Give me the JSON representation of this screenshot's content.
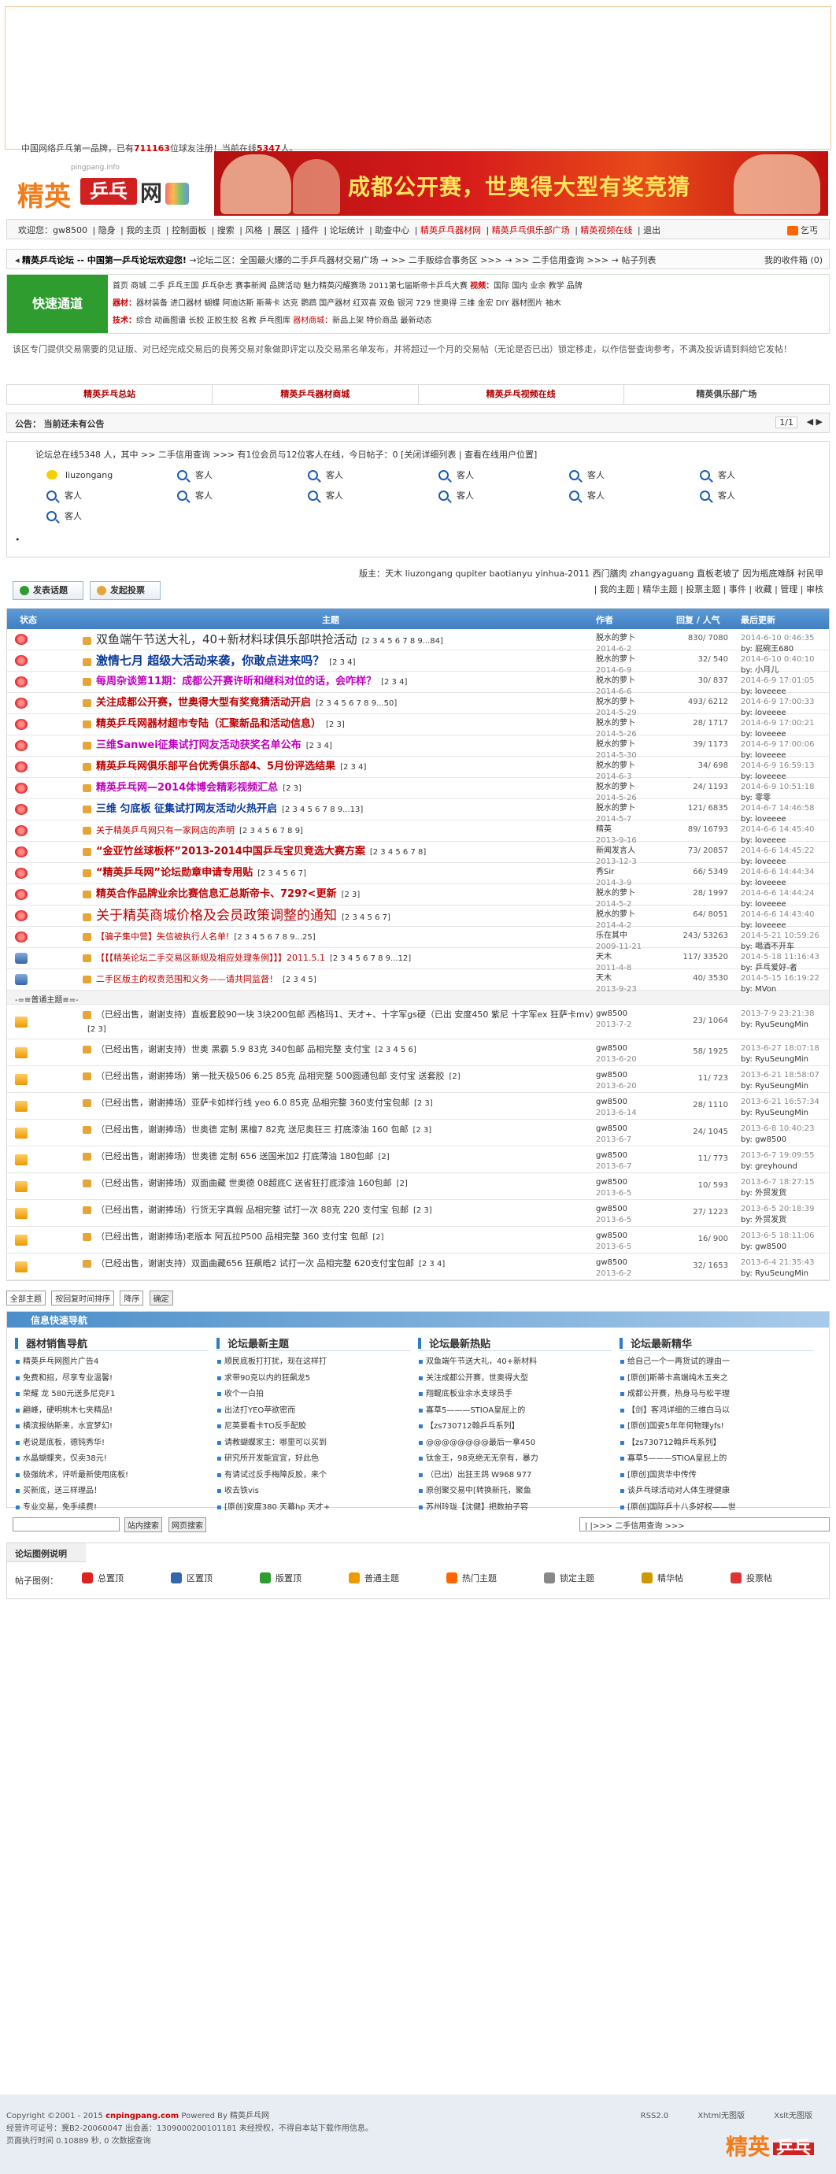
{
  "header": {
    "tagline_pre": "中国网络乒乓第一品牌，已有",
    "registered": "711163",
    "tagline_mid": "位球友注册！当前在线",
    "online_count": "5347",
    "tagline_post": "人。",
    "logo": {
      "sub": "pingpang.info",
      "t1": "精英",
      "t2": "乒乓",
      "t3": "网"
    },
    "banner_text": "成都公开赛，世奥得大型有奖竞猜"
  },
  "usernav": {
    "items": [
      "欢迎您：gw8500",
      "隐身",
      "我的主页",
      "控制面板",
      "搜索",
      "风格",
      "展区",
      "插件",
      "论坛统计",
      "助查中心"
    ],
    "hot_items": [
      "精英乒乓器材网",
      "精英乒乓俱乐部广场",
      "精英视频在线"
    ],
    "exit": "退出",
    "rss": "订阅",
    "right": "乞丐"
  },
  "crumb": {
    "prefix": "精英乒乓论坛 -- 中国第一乒乓论坛欢迎您!",
    "path": "→论坛二区：全国最火爆的二手乒乓器材交易广场 → >> 二手贩综合事务区 >>> → >> 二手信用查询 >>> → 帖子列表",
    "right": "我的收件箱 (0)"
  },
  "quick": {
    "title": "快速通道",
    "row1": "首页 商城 二手 乒乓王国 乒乓杂志 赛事新闻 品牌活动 魅力精英闪耀赛场 2011第七届斯帝卡乒乓大赛",
    "row1_lbl": "视频：",
    "row1_tail": "国际 国内 业余 教学 品牌",
    "row2_lbl": "器材：",
    "row2": "器材装备 进口器材 蝴蝶 阿迪达斯 斯蒂卡 达克 鹦鹉 国产器材 红双喜 双鱼 银河 729 世奥得 三维 金宏 DIY 器材图片 袖木",
    "row3_lbl": "技术：",
    "row3": "综合 动画图谱 长胶 正胶生胶 名教 乒乓图库",
    "row3_red": "器材商城：",
    "row3_tail": "新品上架 特价商品 最新动态"
  },
  "notice": "该区专门提供交易需要的见证版、对已经完成交易后的良莠交易对象做即评定以及交易黑名单发布，并将超过一个月的交易帖（无论是否已出）锁定移走，以作信誉查询参考，不满及投诉请到斜给它发帖！",
  "tabs": [
    "精英乒乓总站",
    "精英乒乓器材商城",
    "精英乒乓视频在线",
    "精英俱乐部广场"
  ],
  "announce": {
    "label": "公告：",
    "text": "当前还未有公告",
    "page": "1/1",
    "arrows": "◀ ▶"
  },
  "online": {
    "header": "论坛总在线5348 人，其中 >> 二手信用查询 >>> 有1位会员与12位客人在线，今日帖子：0  [关闭详细列表 | 查看在线用户位置]",
    "members": [
      "liuzongang"
    ],
    "guest_label": "客人",
    "guest_count": 12
  },
  "actbar": {
    "post_btn": "发表话题",
    "vote_btn": "发起投票",
    "mods": "版主：天木  liuzongang  qupiter  baotianyu  yinhua-2011  西门膳肉  zhangyaguang  直板老坡了  因为瓶底难酥  衬民甲",
    "filters": "| 我的主题 | 精华主题 | 投票主题 | 事件 | 收藏 | 管理 | 审核"
  },
  "table": {
    "headers": {
      "status": "状态",
      "topic": "主题",
      "author": "作者",
      "replies": "回复 / 人气",
      "last": "最后更新"
    },
    "pinned": [
      {
        "icon": "hot",
        "title": "双鱼端午节送大礼，40+新材料球俱乐部哄抢活动",
        "color": "#333",
        "size": 15,
        "bold": false,
        "pages": "[2 3 4 5 6 7 8 9...84]",
        "author": "脱水的萝卜",
        "date": "2014-6-2",
        "rv": "830/ 7080",
        "lp_time": "2014-6-10 0:46:35",
        "lp_by": "by: 屁碗王680"
      },
      {
        "icon": "hot",
        "title": "激情七月 超级大活动来袭，你敢点进来吗？",
        "color": "#0a3a9a",
        "size": 15,
        "bold": true,
        "pages": "[2 3 4]",
        "author": "脱水的萝卜",
        "date": "2014-6-9",
        "rv": "32/ 540",
        "lp_time": "2014-6-10 0:40:10",
        "lp_by": "by: 小月儿"
      },
      {
        "icon": "hot",
        "title": "每周杂谈第11期：成都公开赛许昕和继科对位的话，会咋样？",
        "color": "#c000c0",
        "size": 13,
        "bold": true,
        "pages": "[2 3 4]",
        "author": "脱水的萝卜",
        "date": "2014-6-6",
        "rv": "30/ 837",
        "lp_time": "2014-6-9 17:01:05",
        "lp_by": "by: loveeee"
      },
      {
        "icon": "hot",
        "title": "关注成都公开赛，世奥得大型有奖竞猜活动开启",
        "color": "#c00000",
        "size": 13,
        "bold": true,
        "pages": "[2 3 4 5 6 7 8 9...50]",
        "author": "脱水的萝卜",
        "date": "2014-5-29",
        "rv": "493/ 6212",
        "lp_time": "2014-6-9 17:00:33",
        "lp_by": "by: loveeee"
      },
      {
        "icon": "hot",
        "title": "精英乒乓网器材超市专陆（汇聚新品和活动信息）",
        "color": "#c00000",
        "size": 13,
        "bold": true,
        "pages": "[2 3]",
        "author": "脱水的萝卜",
        "date": "2014-5-26",
        "rv": "28/ 1717",
        "lp_time": "2014-6-9 17:00:21",
        "lp_by": "by: loveeee"
      },
      {
        "icon": "hot",
        "title": "三维Sanwei征集试打网友活动获奖名单公布",
        "color": "#c000c0",
        "size": 13,
        "bold": true,
        "pages": "[2 3 4]",
        "author": "脱水的萝卜",
        "date": "2014-5-30",
        "rv": "39/ 1173",
        "lp_time": "2014-6-9 17:00:06",
        "lp_by": "by: loveeee"
      },
      {
        "icon": "hot",
        "title": "精英乒乓网俱乐部平台优秀俱乐部4、5月份评选结果",
        "color": "#c00000",
        "size": 13,
        "bold": true,
        "pages": "[2 3 4]",
        "author": "脱水的萝卜",
        "date": "2014-6-3",
        "rv": "34/ 698",
        "lp_time": "2014-6-9 16:59:13",
        "lp_by": "by: loveeee"
      },
      {
        "icon": "hot",
        "title": "精英乒乓网—2014体博会精彩视频汇总",
        "color": "#c000c0",
        "size": 13,
        "bold": true,
        "pages": "[2 3]",
        "author": "脱水的萝卜",
        "date": "2014-5-26",
        "rv": "24/ 1193",
        "lp_time": "2014-6-9 10:51:18",
        "lp_by": "by: 零零"
      },
      {
        "icon": "hot",
        "title": "三维 匀底板 征集试打网友活动火热开启",
        "color": "#0a3a9a",
        "size": 13,
        "bold": true,
        "pages": "[2 3 4 5 6 7 8 9...13]",
        "author": "脱水的萝卜",
        "date": "2014-5-7",
        "rv": "121/ 6835",
        "lp_time": "2014-6-7 14:46:58",
        "lp_by": "by: loveeee"
      },
      {
        "icon": "hot",
        "title": "关于精英乒乓网只有一家网店的声明",
        "color": "#c00000",
        "size": 11,
        "bold": false,
        "pages": "[2 3 4 5 6 7 8 9]",
        "author": "精英",
        "date": "2013-9-16",
        "rv": "89/ 16793",
        "lp_time": "2014-6-6 14:45:40",
        "lp_by": "by: loveeee"
      },
      {
        "icon": "hot",
        "title": "“金亚竹丝球板杯”2013-2014中国乒乓宝贝竞选大赛方案",
        "color": "#c00000",
        "size": 13,
        "bold": true,
        "pages": "[2 3 4 5 6 7 8]",
        "author": "新闻发言人",
        "date": "2013-12-3",
        "rv": "73/ 20857",
        "lp_time": "2014-6-6 14:45:22",
        "lp_by": "by: loveeee"
      },
      {
        "icon": "hot",
        "title": "“精英乒乓网”论坛勋章申请专用贴",
        "color": "#c00000",
        "size": 13,
        "bold": true,
        "pages": "[2 3 4 5 6 7]",
        "author": "秀Sir",
        "date": "2014-3-9",
        "rv": "66/ 5349",
        "lp_time": "2014-6-6 14:44:34",
        "lp_by": "by: loveeee"
      },
      {
        "icon": "hot",
        "title": "精英合作品牌业余比赛信息汇总斯帝卡、729?<更新",
        "color": "#c00000",
        "size": 13,
        "bold": true,
        "pages": "[2 3]",
        "author": "脱水的萝卜",
        "date": "2014-5-2",
        "rv": "28/ 1997",
        "lp_time": "2014-6-6 14:44:24",
        "lp_by": "by: loveeee"
      },
      {
        "icon": "hot",
        "title": "关于精英商城价格及会员政策调整的通知",
        "color": "#c00000",
        "size": 17,
        "bold": false,
        "pages": "[2 3 4 5 6 7]",
        "author": "脱水的萝卜",
        "date": "2014-4-2",
        "rv": "64/ 8051",
        "lp_time": "2014-6-6 14:43:40",
        "lp_by": "by: loveeee"
      },
      {
        "icon": "hot",
        "title": "【骗子集中营】失信被执行人名单!",
        "color": "#c00000",
        "size": 11,
        "bold": false,
        "pages": "[2 3 4 5 6 7 8 9...25]",
        "author": "乐在其中",
        "date": "2009-11-21",
        "rv": "243/ 53263",
        "lp_time": "2014-5-21 10:59:26",
        "lp_by": "by: 喝酒不开车"
      },
      {
        "icon": "pin",
        "title": "【【【精英论坛二手交易区新规及相应处理条例】】】2011.5.1",
        "color": "#c00000",
        "size": 11,
        "bold": false,
        "pages": "[2 3 4 5 6 7 8 9...12]",
        "author": "天木",
        "date": "2011-4-8",
        "rv": "117/ 33520",
        "lp_time": "2014-5-18 11:16:43",
        "lp_by": "by: 乒乓爱好-者"
      },
      {
        "icon": "pin",
        "title": "二手区版主的权责范围和义务——请共同监督！",
        "color": "#c00000",
        "size": 11,
        "bold": false,
        "pages": "[2 3 4 5]",
        "author": "天木",
        "date": "2013-9-23",
        "rv": "40/ 3530",
        "lp_time": "2014-5-15 16:19:22",
        "lp_by": "by: MVon"
      }
    ],
    "separator": "-=≡普通主题≡=-",
    "normal": [
      {
        "title": "（已经出售，谢谢支持）直板套胶90一块 3块200包邮 西格玛1、天才+、十字军gs硬（已出 安度450 紫尼 十字军ex 狂萨卡mv）",
        "pages": "[2 3]",
        "author": "gw8500",
        "date": "2013-7-2",
        "rv": "23/ 1064",
        "lp_time": "2013-7-9 23:21:38",
        "lp_by": "by: RyuSeungMin",
        "two": true
      },
      {
        "title": "（已经出售，谢谢支持）世奥 黑霸 5.9 83克 340包邮 品相完整 支付宝",
        "pages": "[2 3 4 5 6]",
        "author": "gw8500",
        "date": "2013-6-20",
        "rv": "58/ 1925",
        "lp_time": "2013-6-27 18:07:18",
        "lp_by": "by: RyuSeungMin"
      },
      {
        "title": "（已经出售，谢谢捧场）第一批天极506 6.25 85克 品相完整 500圆通包邮 支付宝 送套胶",
        "pages": "[2]",
        "author": "gw8500",
        "date": "2013-6-20",
        "rv": "11/ 723",
        "lp_time": "2013-6-21 18:58:07",
        "lp_by": "by: RyuSeungMin"
      },
      {
        "title": "（已经出售，谢谢捧场）亚萨卡如样行线 yeo 6.0 85克 品相完整 360支付宝包邮",
        "pages": "[2 3]",
        "author": "gw8500",
        "date": "2013-6-14",
        "rv": "28/ 1110",
        "lp_time": "2013-6-21 16:57:34",
        "lp_by": "by: RyuSeungMin"
      },
      {
        "title": "（已经出售，谢谢捧场）世奥德 定制 黑檀7 82克 送尼奥狂三 打底漆油 160 包邮",
        "pages": "[2 3]",
        "author": "gw8500",
        "date": "2013-6-7",
        "rv": "24/ 1045",
        "lp_time": "2013-6-8 10:40:23",
        "lp_by": "by: gw8500"
      },
      {
        "title": "（已经出售，谢谢捧场）世奥德 定制 656 送国米加2 打底薄油 180包邮",
        "pages": "[2]",
        "author": "gw8500",
        "date": "2013-6-7",
        "rv": "11/ 773",
        "lp_time": "2013-6-7 19:09:55",
        "lp_by": "by: greyhound"
      },
      {
        "title": "（已经出售，谢谢捧场）双面曲藏 世奥德 08超底C 送省狂打底漆油 160包邮",
        "pages": "[2]",
        "author": "gw8500",
        "date": "2013-6-5",
        "rv": "10/ 593",
        "lp_time": "2013-6-7 18:27:15",
        "lp_by": "by: 外贸发货"
      },
      {
        "title": "（已经出售，谢谢捧场）行货无字真假 品相完整 试打一次 88克 220 支付宝 包邮",
        "pages": "[2 3]",
        "author": "gw8500",
        "date": "2013-6-5",
        "rv": "27/ 1223",
        "lp_time": "2013-6-5 20:18:39",
        "lp_by": "by: 外贸发货"
      },
      {
        "title": "（已经出售，谢谢捧场)老版本 阿瓦拉P500 品相完整 360 支付宝 包邮",
        "pages": "[2]",
        "author": "gw8500",
        "date": "2013-6-5",
        "rv": "16/ 900",
        "lp_time": "2013-6-5 18:11:06",
        "lp_by": "by: gw8500"
      },
      {
        "title": "（已经出售，谢谢支持）双面曲藏656 狂飙皓2 试打一次 品相完整 620支付宝包邮",
        "pages": "[2 3 4]",
        "author": "gw8500",
        "date": "2013-6-2",
        "rv": "32/ 1653",
        "lp_time": "2013-6-4 21:35:43",
        "lp_by": "by: RyuSeungMin"
      }
    ]
  },
  "bottomctl": {
    "sel1": "全部主题",
    "sel2": "按回复时间排序",
    "sel3": "降序",
    "ok": "确定"
  },
  "info": {
    "title": "信息快速导航",
    "cols": [
      {
        "title": "器材销售导航",
        "items": [
          "精英乒乓网图片广告4",
          "免费和招，尽享专业温馨!",
          "荣耀 龙 580元送多尼克F1",
          "翩峰，硬明桃木七夹精品!",
          "横滨报纳斯来，水宜梦幻!",
          "老说是底板，德钝秀华!",
          "水晶蝴蝶夹，仅卖38元!",
          "极强统术，评听最新使用底板!",
          "买新底，送三样理品！",
          "专业交易，免手续费!"
        ]
      },
      {
        "title": "论坛最新主题",
        "items": [
          "顺民底板打打扰，现在这样打",
          "求带90克以内的狂飙龙5",
          "收个一白拍",
          "出法打YEO苹欲密而",
          "尼英要看卡TO反手配胶",
          "请教蝴蝶家主：哪里可以买到",
          "研究所开发能宜宜，好此色",
          "有请试过反手梅障反胶，来个",
          "收去铁vis",
          "[原创]安度380 天幕hp 天才+"
        ]
      },
      {
        "title": "论坛最新热贴",
        "items": [
          "双鱼端午节送大礼，40+新材料",
          "关注成都公开赛，世奥得大型",
          "翔鲲底板业余水支球员手",
          "寡草5———STIOA皇屁上的",
          "【zs730712翰乒乓系列】",
          "@@@@@@@@最后一拿450",
          "钛金王，98克绝无无奈有，暴力",
          "（已出）出狂王鸽 W968 977",
          "原创聚交易中[转换新托，聚鱼",
          "苏州玲珑【沈健】把数拍子容"
        ]
      },
      {
        "title": "论坛最新精华",
        "items": [
          "给自己一个一再货试的理由一",
          "[原创]斯蒂卡高端纯木五夹之",
          "成都公开赛，热身马与松平理",
          "【剑】客鸿详细的三维白马以",
          "[原创]国瓷5年年何物理yfs!",
          "【zs730712翰乒乓系列】",
          "寡草5———STIOA皇屁上的",
          "[原创]国货华中传传",
          "谈乒乓球活动对人体生理健康",
          "[原创]国际乒十八多好权——世"
        ]
      }
    ]
  },
  "search": {
    "btn1": "站内搜索",
    "btn2": "网页搜索",
    "jump": "| |>>> 二手信用查询 >>>"
  },
  "legend": {
    "title": "论坛图例说明",
    "prefix": "帖子图例：",
    "items": [
      "总置顶",
      "区置顶",
      "版置顶",
      "普通主题",
      "热门主题",
      "锁定主题",
      "精华帖",
      "投票帖"
    ]
  },
  "footer": {
    "line1_pre": "Copyright ©2001 - 2015",
    "domain": "cnpingpang.com",
    "line1_post": "Powered By 精英乒乓网",
    "line2": "经营许可证号：冀B2-20060047 出会盖：1309000200101181 未经授权，不得自本站下载作用信息。",
    "line3": "页面执行时间 0.10889 秒, 0 次数据查询",
    "links": [
      "RSS2.0",
      "Xhtml无图版",
      "Xslt无图版"
    ]
  },
  "colors": {
    "accent": "#3f7fc3",
    "brand": "#f37c1a",
    "red": "#c00000",
    "green": "#2e9c2e"
  }
}
